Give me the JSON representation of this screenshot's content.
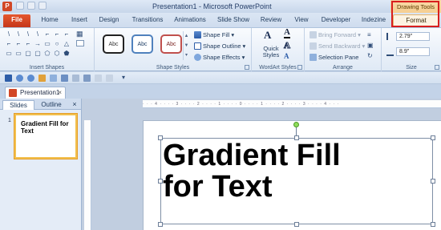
{
  "window": {
    "title": "Presentation1 - Microsoft PowerPoint",
    "app_icon_letter": "P"
  },
  "context_tools": {
    "label": "Drawing Tools"
  },
  "tabs": [
    {
      "label": "File"
    },
    {
      "label": "Home"
    },
    {
      "label": "Insert"
    },
    {
      "label": "Design"
    },
    {
      "label": "Transitions"
    },
    {
      "label": "Animations"
    },
    {
      "label": "Slide Show"
    },
    {
      "label": "Review"
    },
    {
      "label": "View"
    },
    {
      "label": "Developer"
    },
    {
      "label": "Indezine"
    },
    {
      "label": "Format"
    }
  ],
  "ribbon": {
    "insert_shapes": {
      "label": "Insert Shapes",
      "shapes": [
        "\\",
        "\\",
        "\\",
        "\\",
        "⌐",
        "⌐",
        "⌐",
        "⌐",
        "⌐",
        "⌐",
        "→",
        "▭",
        "○",
        "△",
        "▭",
        "▭",
        "▢",
        "▢",
        "⬠",
        "⬡",
        "⬟"
      ]
    },
    "shape_styles": {
      "label": "Shape Styles",
      "presets": [
        "Abc",
        "Abc",
        "Abc"
      ],
      "fill": "Shape Fill",
      "outline": "Shape Outline",
      "effects": "Shape Effects"
    },
    "wordart_styles": {
      "label": "WordArt Styles",
      "quick_styles": "Quick",
      "quick_styles_2": "Styles"
    },
    "arrange": {
      "label": "Arrange",
      "bring_forward": "Bring Forward",
      "send_backward": "Send Backward",
      "selection_pane": "Selection Pane"
    },
    "size": {
      "label": "Size",
      "height": "2.79\"",
      "width": "8.9\""
    }
  },
  "document": {
    "tab_name": "Presentation1"
  },
  "left_pane": {
    "tab_slides": "Slides",
    "tab_outline": "Outline",
    "close_glyph": "×",
    "slide_number": "1",
    "thumb_text": "Gradient Fill for Text"
  },
  "ruler": {
    "marks": "· · · 4 · · · · 3 · · · · 2 · · · · 1 · · · · 0 · · · · 1 · · · · 2 · · · · 3 · · · · 4 · · ·"
  },
  "slide": {
    "line1": "Gradient Fill",
    "line2": "for Text"
  },
  "colors": {
    "file_tab": "#d24726",
    "context_header": "#f3c177",
    "highlight_outline": "#d81e1e",
    "rotation_handle": "#8fdc5b"
  }
}
